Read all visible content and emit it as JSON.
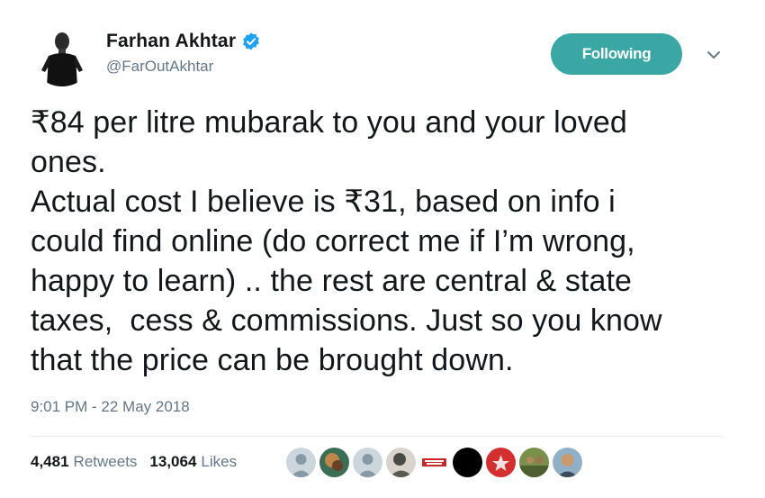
{
  "user": {
    "display_name": "Farhan Akhtar",
    "handle": "@FarOutAkhtar",
    "verified": true
  },
  "follow_button": {
    "label": "Following",
    "color": "#3aa7a4"
  },
  "tweet": {
    "text": "₹84 per litre mubarak to you and your loved\nones.\nActual cost I believe is ₹31, based on info i\ncould find online (do correct me if I’m wrong,\nhappy to learn) .. the rest are central & state\ntaxes,  cess & commissions. Just so you know\nthat the price can be brought down.",
    "timestamp": "9:01 PM - 22 May 2018"
  },
  "stats": {
    "retweets_count": "4,481",
    "retweets_label": "Retweets",
    "likes_count": "13,064",
    "likes_label": "Likes"
  },
  "likers": [
    "default-avatar-icon",
    "liker-photo",
    "default-avatar-icon",
    "liker-photo",
    "liker-logo",
    "liker-photo",
    "liker-photo",
    "liker-photo",
    "liker-photo"
  ],
  "colors": {
    "verified": "#1da1f2",
    "secondary_text": "#657786",
    "primary_text": "#14171a"
  }
}
